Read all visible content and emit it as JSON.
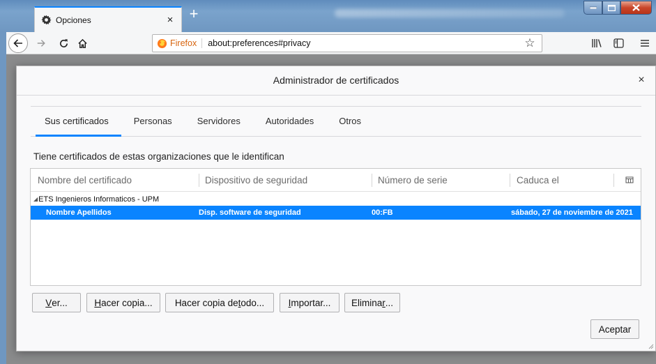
{
  "browser": {
    "tab_title": "Opciones",
    "tab_close": "×",
    "new_tab": "+",
    "identity_label": "Firefox",
    "url": "about:preferences#privacy",
    "icons": [
      "back-icon",
      "forward-icon",
      "reload-icon",
      "home-icon",
      "bookmark-star-icon",
      "library-icon",
      "sidebar-icon",
      "menu-icon"
    ]
  },
  "dialog": {
    "title": "Administrador de certificados",
    "close": "×",
    "tabs": [
      {
        "label": "Sus certificados",
        "active": true
      },
      {
        "label": "Personas",
        "active": false
      },
      {
        "label": "Servidores",
        "active": false
      },
      {
        "label": "Autoridades",
        "active": false
      },
      {
        "label": "Otros",
        "active": false
      }
    ],
    "description": "Tiene certificados de estas organizaciones que le identifican",
    "columns": [
      "Nombre del certificado",
      "Dispositivo de seguridad",
      "Número de serie",
      "Caduca el"
    ],
    "group": {
      "twisty": "◢",
      "name": "ETS Ingenieros Informaticos - UPM"
    },
    "rows": [
      {
        "name": "Nombre Apellidos",
        "device": "Disp. software de seguridad",
        "serial": "00:FB",
        "expires": "sábado, 27 de noviembre de 2021",
        "selected": true
      }
    ],
    "buttons": {
      "view": {
        "accel": "V",
        "rest": "er..."
      },
      "backup": {
        "pre": "",
        "accel": "H",
        "rest": "acer copia..."
      },
      "backup_all": {
        "pre": "Hacer copia de ",
        "accel": "t",
        "rest": "odo..."
      },
      "import": {
        "accel": "I",
        "rest": "mportar..."
      },
      "delete": {
        "pre": "Elimina",
        "accel": "r",
        "rest": "..."
      },
      "accept": "Aceptar"
    },
    "accent_color": "#0a84ff"
  }
}
